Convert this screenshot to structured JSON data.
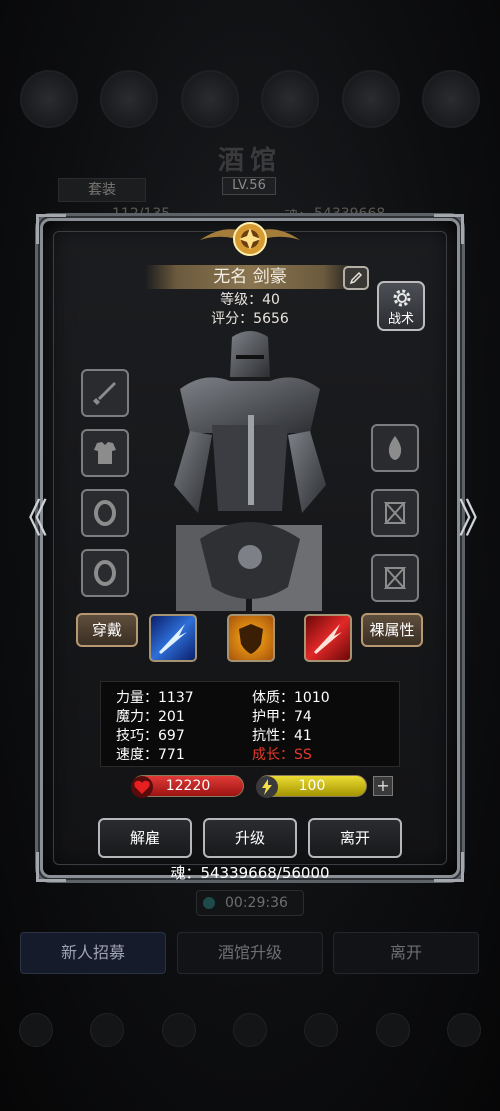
{
  "background": {
    "title": "酒馆",
    "suit_tab": "套装",
    "level_badge": "LV.56",
    "row_left": "112/135",
    "row_right_label": "魂：",
    "row_right_value": "54339668",
    "timer": "00:29:36",
    "buttons": [
      "新人招募",
      "酒馆升级",
      "离开"
    ]
  },
  "hero": {
    "name": "无名 剑豪",
    "level": "等级：40",
    "score": "评分：5656",
    "tactic_label": "战术"
  },
  "equip_buttons": {
    "wear": "穿戴",
    "naked_attr": "裸属性"
  },
  "stats": {
    "strength": "力量：1137",
    "constitution": "体质：1010",
    "magic": "魔力：201",
    "armor": "护甲：74",
    "skill": "技巧：697",
    "resistance": "抗性：41",
    "speed": "速度：771",
    "growth": "成长：SS"
  },
  "bars": {
    "hp": "12220",
    "energy": "100",
    "plus": "+"
  },
  "actions": {
    "dismiss": "解雇",
    "upgrade": "升级",
    "leave": "离开"
  },
  "soul": "魂：54339668/56000",
  "colors": {
    "growth": "#e53a2a",
    "hp_bar": "#c0201f",
    "energy_bar": "#c8b400",
    "frame": "#8a8f96"
  }
}
